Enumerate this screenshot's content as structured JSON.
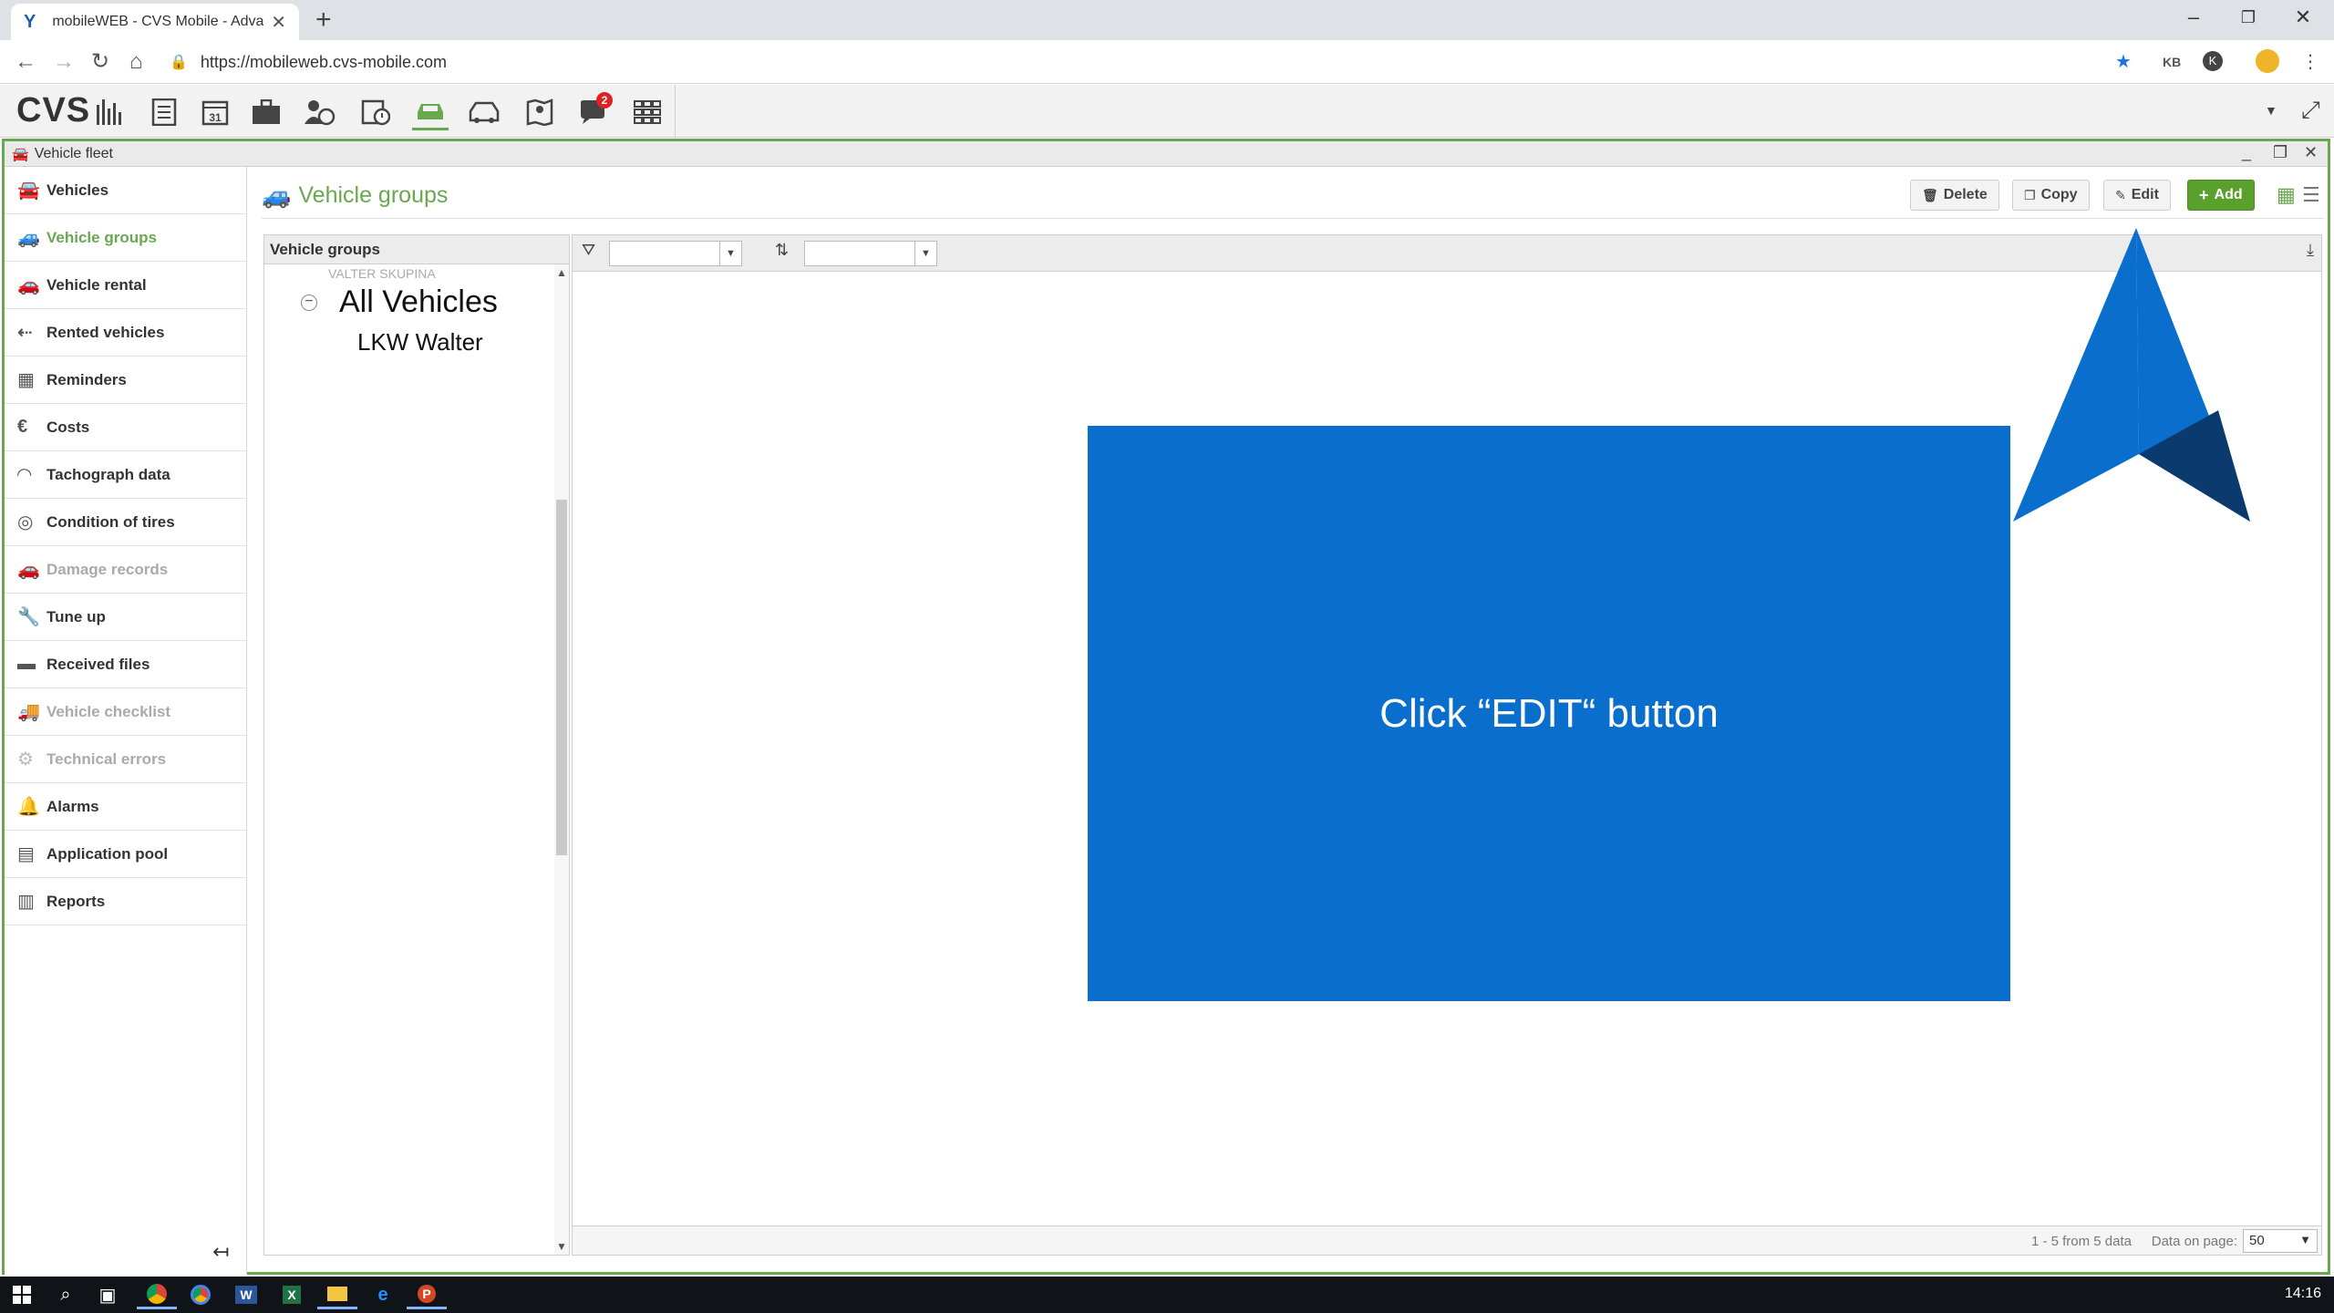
{
  "browser": {
    "tab_title": "mobileWEB - CVS Mobile - Advan",
    "url": "https://mobileweb.cvs-mobile.com",
    "profile_initial": "K"
  },
  "app": {
    "logo": "CVS",
    "notification_count": "2",
    "topbar_icons": [
      "statistics-icon",
      "document-icon",
      "calendar-icon",
      "briefcase-icon",
      "person-map-icon",
      "schedule-icon",
      "car-icon",
      "car-group-icon",
      "map-icon",
      "chat-icon",
      "grid-icon"
    ]
  },
  "window": {
    "title": "Vehicle fleet"
  },
  "sidebar": {
    "items": [
      {
        "label": "Vehicles",
        "state": "normal"
      },
      {
        "label": "Vehicle groups",
        "state": "active"
      },
      {
        "label": "Vehicle rental",
        "state": "normal"
      },
      {
        "label": "Rented vehicles",
        "state": "normal"
      },
      {
        "label": "Reminders",
        "state": "normal"
      },
      {
        "label": "Costs",
        "state": "normal"
      },
      {
        "label": "Tachograph data",
        "state": "normal"
      },
      {
        "label": "Condition of tires",
        "state": "normal"
      },
      {
        "label": "Damage records",
        "state": "disabled"
      },
      {
        "label": "Tune up",
        "state": "normal"
      },
      {
        "label": "Received files",
        "state": "normal"
      },
      {
        "label": "Vehicle checklist",
        "state": "disabled"
      },
      {
        "label": "Technical errors",
        "state": "disabled"
      },
      {
        "label": "Alarms",
        "state": "normal"
      },
      {
        "label": "Application pool",
        "state": "normal"
      },
      {
        "label": "Reports",
        "state": "normal"
      }
    ]
  },
  "main": {
    "title": "Vehicle groups",
    "buttons": {
      "delete": "Delete",
      "copy": "Copy",
      "edit": "Edit",
      "add": "Add"
    },
    "tree": {
      "header": "Vehicle groups",
      "partial_item": "VALTER SKUPINA",
      "root": "All Vehicles",
      "child": "LKW Walter"
    },
    "grid": {
      "filter_value": "",
      "sort_value": "",
      "footer_info": "1 - 5 from 5 data",
      "data_on_page_label": "Data on page:",
      "data_on_page_value": "50"
    }
  },
  "overlay": {
    "instruction": "Click “EDIT“ button",
    "box_color": "#0a6fcc",
    "pointer_color": "#0a6fcc",
    "pointer_shade": "#0a3a6e"
  },
  "taskbar": {
    "time": "14:16"
  },
  "colors": {
    "accent": "#6aa84f",
    "add_button": "#5aa02c"
  }
}
